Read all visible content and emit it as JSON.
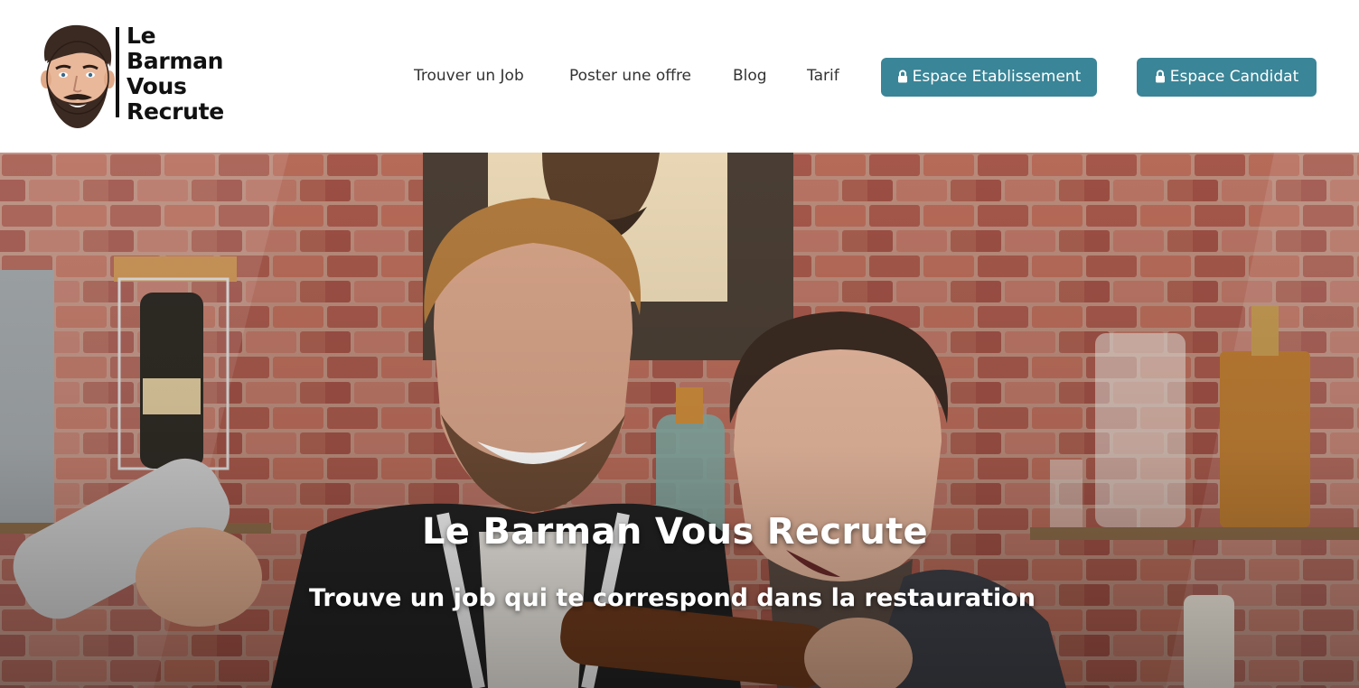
{
  "brand": {
    "logo_lines": [
      "Le",
      "Barman",
      "Vous",
      "Recrute"
    ]
  },
  "nav": {
    "items": [
      {
        "label": "Trouver un Job"
      },
      {
        "label": "Poster une offre"
      },
      {
        "label": "Blog"
      },
      {
        "label": "Tarif"
      }
    ]
  },
  "actions": {
    "establishment_label": "Espace Etablissement",
    "candidate_label": "Espace Candidat",
    "icon": "lock-icon",
    "button_color": "#3a8597"
  },
  "hero": {
    "title": "Le Barman Vous Recrute",
    "subtitle": "Trouve un job qui te correspond dans la restauration",
    "image": "hero-photo-two-bartenders-brick-wall"
  }
}
